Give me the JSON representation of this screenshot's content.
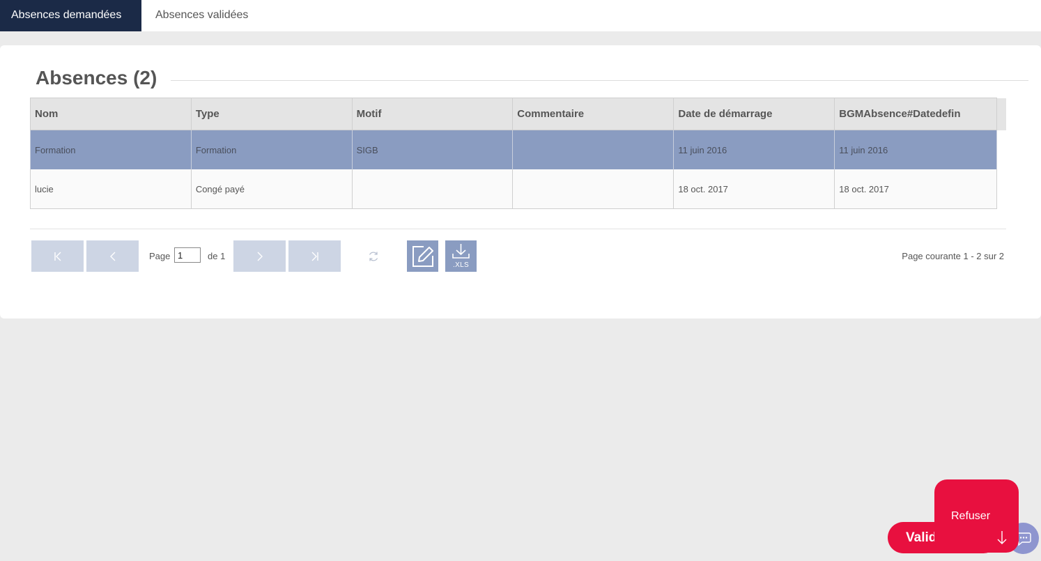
{
  "tabs": [
    {
      "label": "Absences demandées",
      "active": true
    },
    {
      "label": "Absences validées",
      "active": false
    }
  ],
  "panel": {
    "title": "Absences (2)"
  },
  "grid": {
    "columns": [
      "Nom",
      "Type",
      "Motif",
      "Commentaire",
      "Date de démarrage",
      "BGMAbsence#Datedefin"
    ],
    "rows": [
      {
        "nom": "Formation",
        "type": "Formation",
        "motif": "SIGB",
        "commentaire": "",
        "debut": "11 juin 2016",
        "fin": "11 juin 2016",
        "selected": true
      },
      {
        "nom": "lucie",
        "type": "Congé payé",
        "motif": "",
        "commentaire": "",
        "debut": "18 oct. 2017",
        "fin": "18 oct. 2017",
        "selected": false
      }
    ]
  },
  "pagination": {
    "page_label": "Page",
    "page_value": "1",
    "of_label": "de 1",
    "status": "Page courante 1 - 2 sur 2",
    "xls_label": ".XLS"
  },
  "actions": {
    "valid_label": "Valid",
    "refuse_label": "Refuser"
  },
  "colors": {
    "tab_active_bg": "#1b2a47",
    "row_selected_bg": "#8a9cc1",
    "pager_button_bg": "#cdd5e4",
    "action_red": "#e8103f",
    "chat_bg": "#8e95cf"
  },
  "icons": {
    "first": "first-page-icon",
    "prev": "previous-page-icon",
    "next": "next-page-icon",
    "last": "last-page-icon",
    "refresh": "refresh-icon",
    "edit": "edit-icon",
    "download": "download-xls-icon",
    "chat": "chat-icon",
    "arrow": "arrow-down-icon"
  }
}
